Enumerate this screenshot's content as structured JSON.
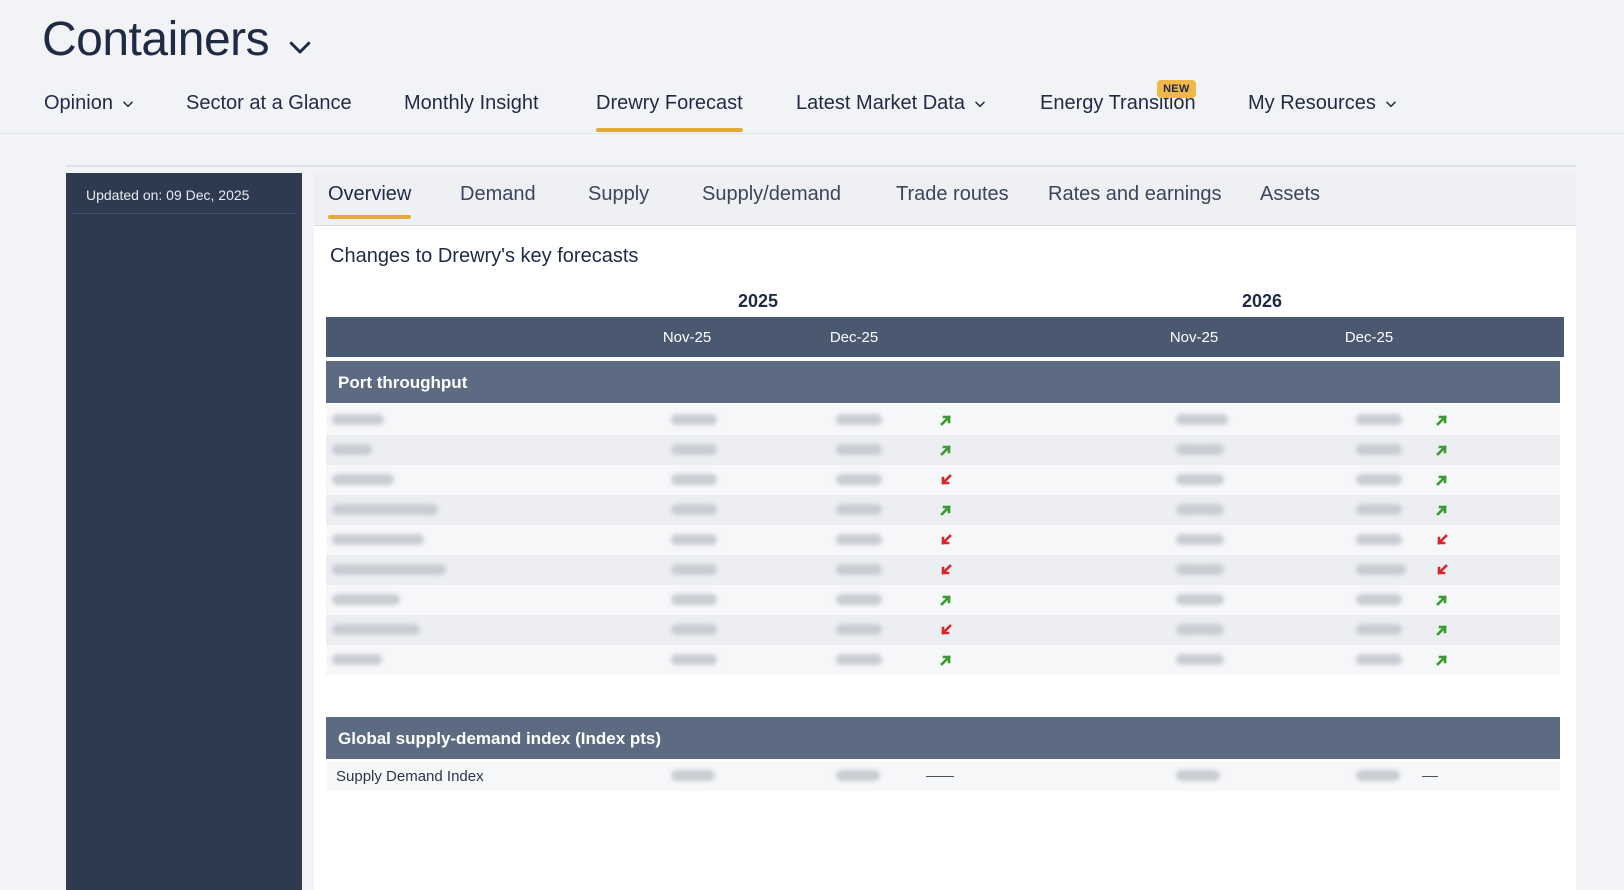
{
  "app": {
    "title": "Containers"
  },
  "nav": [
    {
      "label": "Opinion",
      "has_dropdown": true,
      "active": false
    },
    {
      "label": "Sector at a Glance",
      "has_dropdown": false,
      "active": false
    },
    {
      "label": "Monthly Insight",
      "has_dropdown": false,
      "active": false
    },
    {
      "label": "Drewry Forecast",
      "has_dropdown": false,
      "active": true
    },
    {
      "label": "Latest Market Data",
      "has_dropdown": true,
      "active": false
    },
    {
      "label": "Energy Transition",
      "has_dropdown": false,
      "active": false,
      "badge": "NEW"
    },
    {
      "label": "My Resources",
      "has_dropdown": true,
      "active": false
    }
  ],
  "sidebar": {
    "updated": "Updated on: 09 Dec, 2025"
  },
  "tabs": [
    {
      "label": "Overview",
      "active": true
    },
    {
      "label": "Demand",
      "active": false
    },
    {
      "label": "Supply",
      "active": false
    },
    {
      "label": "Supply/demand",
      "active": false
    },
    {
      "label": "Trade routes",
      "active": false
    },
    {
      "label": "Rates and earnings",
      "active": false
    },
    {
      "label": "Assets",
      "active": false
    }
  ],
  "content": {
    "title": "Changes to Drewry's key forecasts",
    "years": [
      "2025",
      "2026"
    ],
    "columns": [
      "Nov-25",
      "Dec-25",
      "Nov-25",
      "Dec-25"
    ],
    "groups": [
      {
        "title": "Port throughput",
        "rows": [
          {
            "label": "",
            "blurred": true,
            "trend_2025": "up",
            "trend_2026": "up"
          },
          {
            "label": "",
            "blurred": true,
            "trend_2025": "up",
            "trend_2026": "up"
          },
          {
            "label": "",
            "blurred": true,
            "trend_2025": "down",
            "trend_2026": "up"
          },
          {
            "label": "",
            "blurred": true,
            "trend_2025": "up",
            "trend_2026": "up"
          },
          {
            "label": "",
            "blurred": true,
            "trend_2025": "down",
            "trend_2026": "down"
          },
          {
            "label": "",
            "blurred": true,
            "trend_2025": "down",
            "trend_2026": "down"
          },
          {
            "label": "",
            "blurred": true,
            "trend_2025": "up",
            "trend_2026": "up"
          },
          {
            "label": "",
            "blurred": true,
            "trend_2025": "down",
            "trend_2026": "up"
          },
          {
            "label": "",
            "blurred": true,
            "trend_2025": "up",
            "trend_2026": "up"
          }
        ]
      },
      {
        "title": "Global supply-demand index (Index pts)",
        "rows": [
          {
            "label": "Supply Demand Index",
            "blurred": false,
            "trend_2025": "flat",
            "trend_2026": "flat"
          }
        ]
      }
    ]
  },
  "colors": {
    "accent": "#e5a93a",
    "up": "#3a9a2e",
    "down": "#d7262b",
    "sidebar": "#2d3a4f",
    "table_header": "#4a5870",
    "group_header": "#5c6a82"
  }
}
